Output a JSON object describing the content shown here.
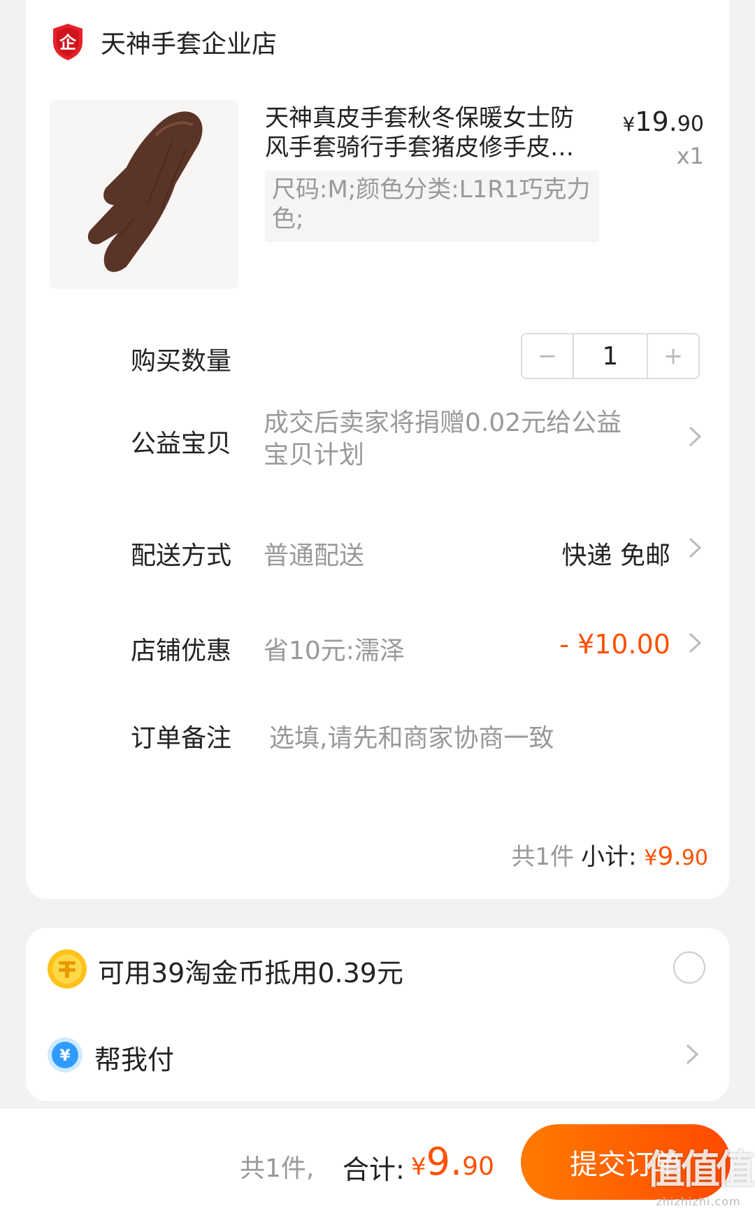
{
  "store": {
    "name": "天神手套企业店",
    "badge_icon": "enterprise-shield-icon",
    "badge_text": "企"
  },
  "product": {
    "title": "天神真皮手套秋冬保暖女士防风手套骑行手套猪皮修手皮…",
    "sku": "尺码:M;颜色分类:L1R1巧克力色;",
    "price_yen": "¥",
    "price_int": "19.",
    "price_dec": "90",
    "quantity_mult": "x1"
  },
  "quantity": {
    "label": "购买数量",
    "minus": "−",
    "value": "1",
    "plus": "+"
  },
  "charity": {
    "label": "公益宝贝",
    "text": "成交后卖家将捐赠0.02元给公益宝贝计划"
  },
  "delivery": {
    "label": "配送方式",
    "method": "普通配送",
    "right": "快递 免邮"
  },
  "shop_discount": {
    "label": "店铺优惠",
    "text": "省10元:濡泽",
    "amount": "- ¥10.00"
  },
  "remark": {
    "label": "订单备注",
    "placeholder": "选填,请先和商家协商一致"
  },
  "subtotal": {
    "count": "共1件",
    "label": "小计:",
    "yen": "¥",
    "int": "9.",
    "dec": "90"
  },
  "coins": {
    "text": "可用39淘金币抵用0.39元",
    "selected": false
  },
  "help_pay": {
    "text": "帮我付"
  },
  "footer": {
    "count": "共1件,",
    "label": "合计:",
    "yen": "¥",
    "int": "9.",
    "dec": "90",
    "submit": "提交订单"
  },
  "watermark": {
    "big": "值值值",
    "small": "zhizhizhi.com"
  },
  "colors": {
    "accent": "#ff5000",
    "button_start": "#ff7a00",
    "button_end": "#ff4a00",
    "background": "#f2f2f2"
  }
}
